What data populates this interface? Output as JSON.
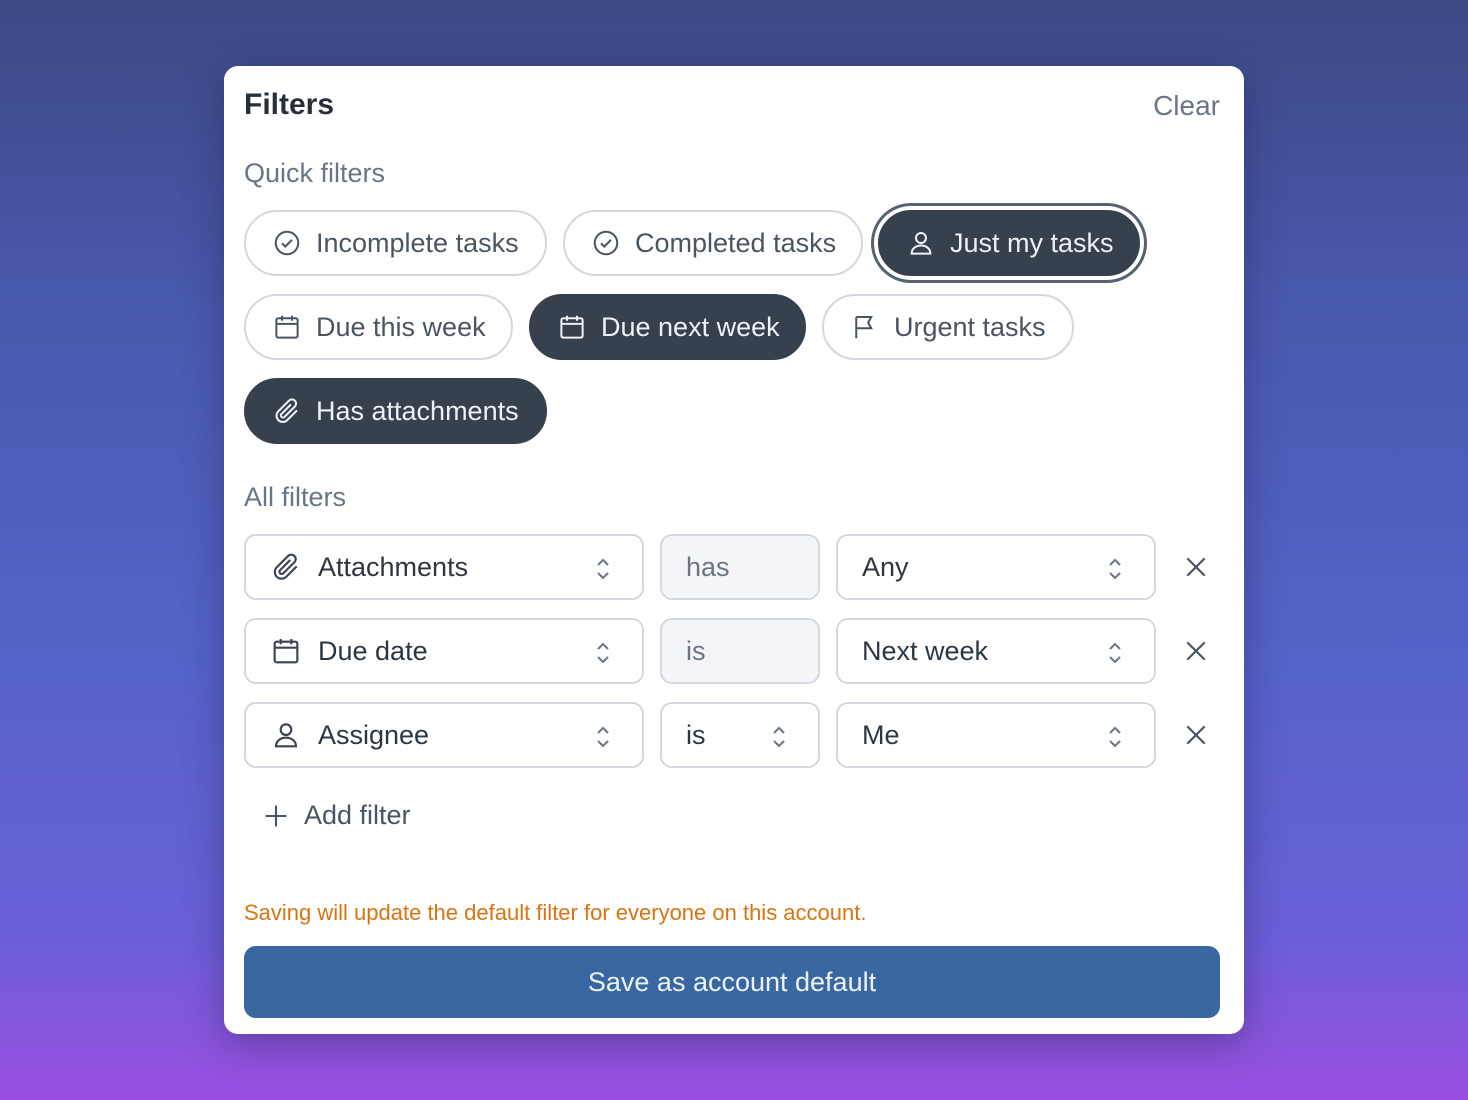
{
  "header": {
    "title": "Filters",
    "clear_label": "Clear"
  },
  "quick_filters": {
    "label": "Quick filters",
    "chips": [
      {
        "label": "Incomplete tasks",
        "icon": "check-circle-icon",
        "active": false
      },
      {
        "label": "Completed tasks",
        "icon": "check-circle-icon",
        "active": false
      },
      {
        "label": "Just my tasks",
        "icon": "user-icon",
        "active": true
      },
      {
        "label": "Due this week",
        "icon": "calendar-icon",
        "active": false
      },
      {
        "label": "Due next week",
        "icon": "calendar-icon",
        "active": true
      },
      {
        "label": "Urgent tasks",
        "icon": "flag-icon",
        "active": false
      },
      {
        "label": "Has attachments",
        "icon": "paperclip-icon",
        "active": true
      }
    ]
  },
  "all_filters": {
    "label": "All filters",
    "rows": [
      {
        "field": "Attachments",
        "field_icon": "paperclip-icon",
        "operator": "has",
        "operator_selectable": false,
        "value": "Any"
      },
      {
        "field": "Due date",
        "field_icon": "calendar-icon",
        "operator": "is",
        "operator_selectable": false,
        "value": "Next week"
      },
      {
        "field": "Assignee",
        "field_icon": "user-icon",
        "operator": "is",
        "operator_selectable": true,
        "value": "Me"
      }
    ],
    "add_label": "Add filter"
  },
  "footer": {
    "warning": "Saving will update the default filter for everyone on this account.",
    "save_label": "Save as account default"
  },
  "colors": {
    "active_chip": "#37414d",
    "primary": "#3867a2",
    "warning": "#d9740f"
  }
}
